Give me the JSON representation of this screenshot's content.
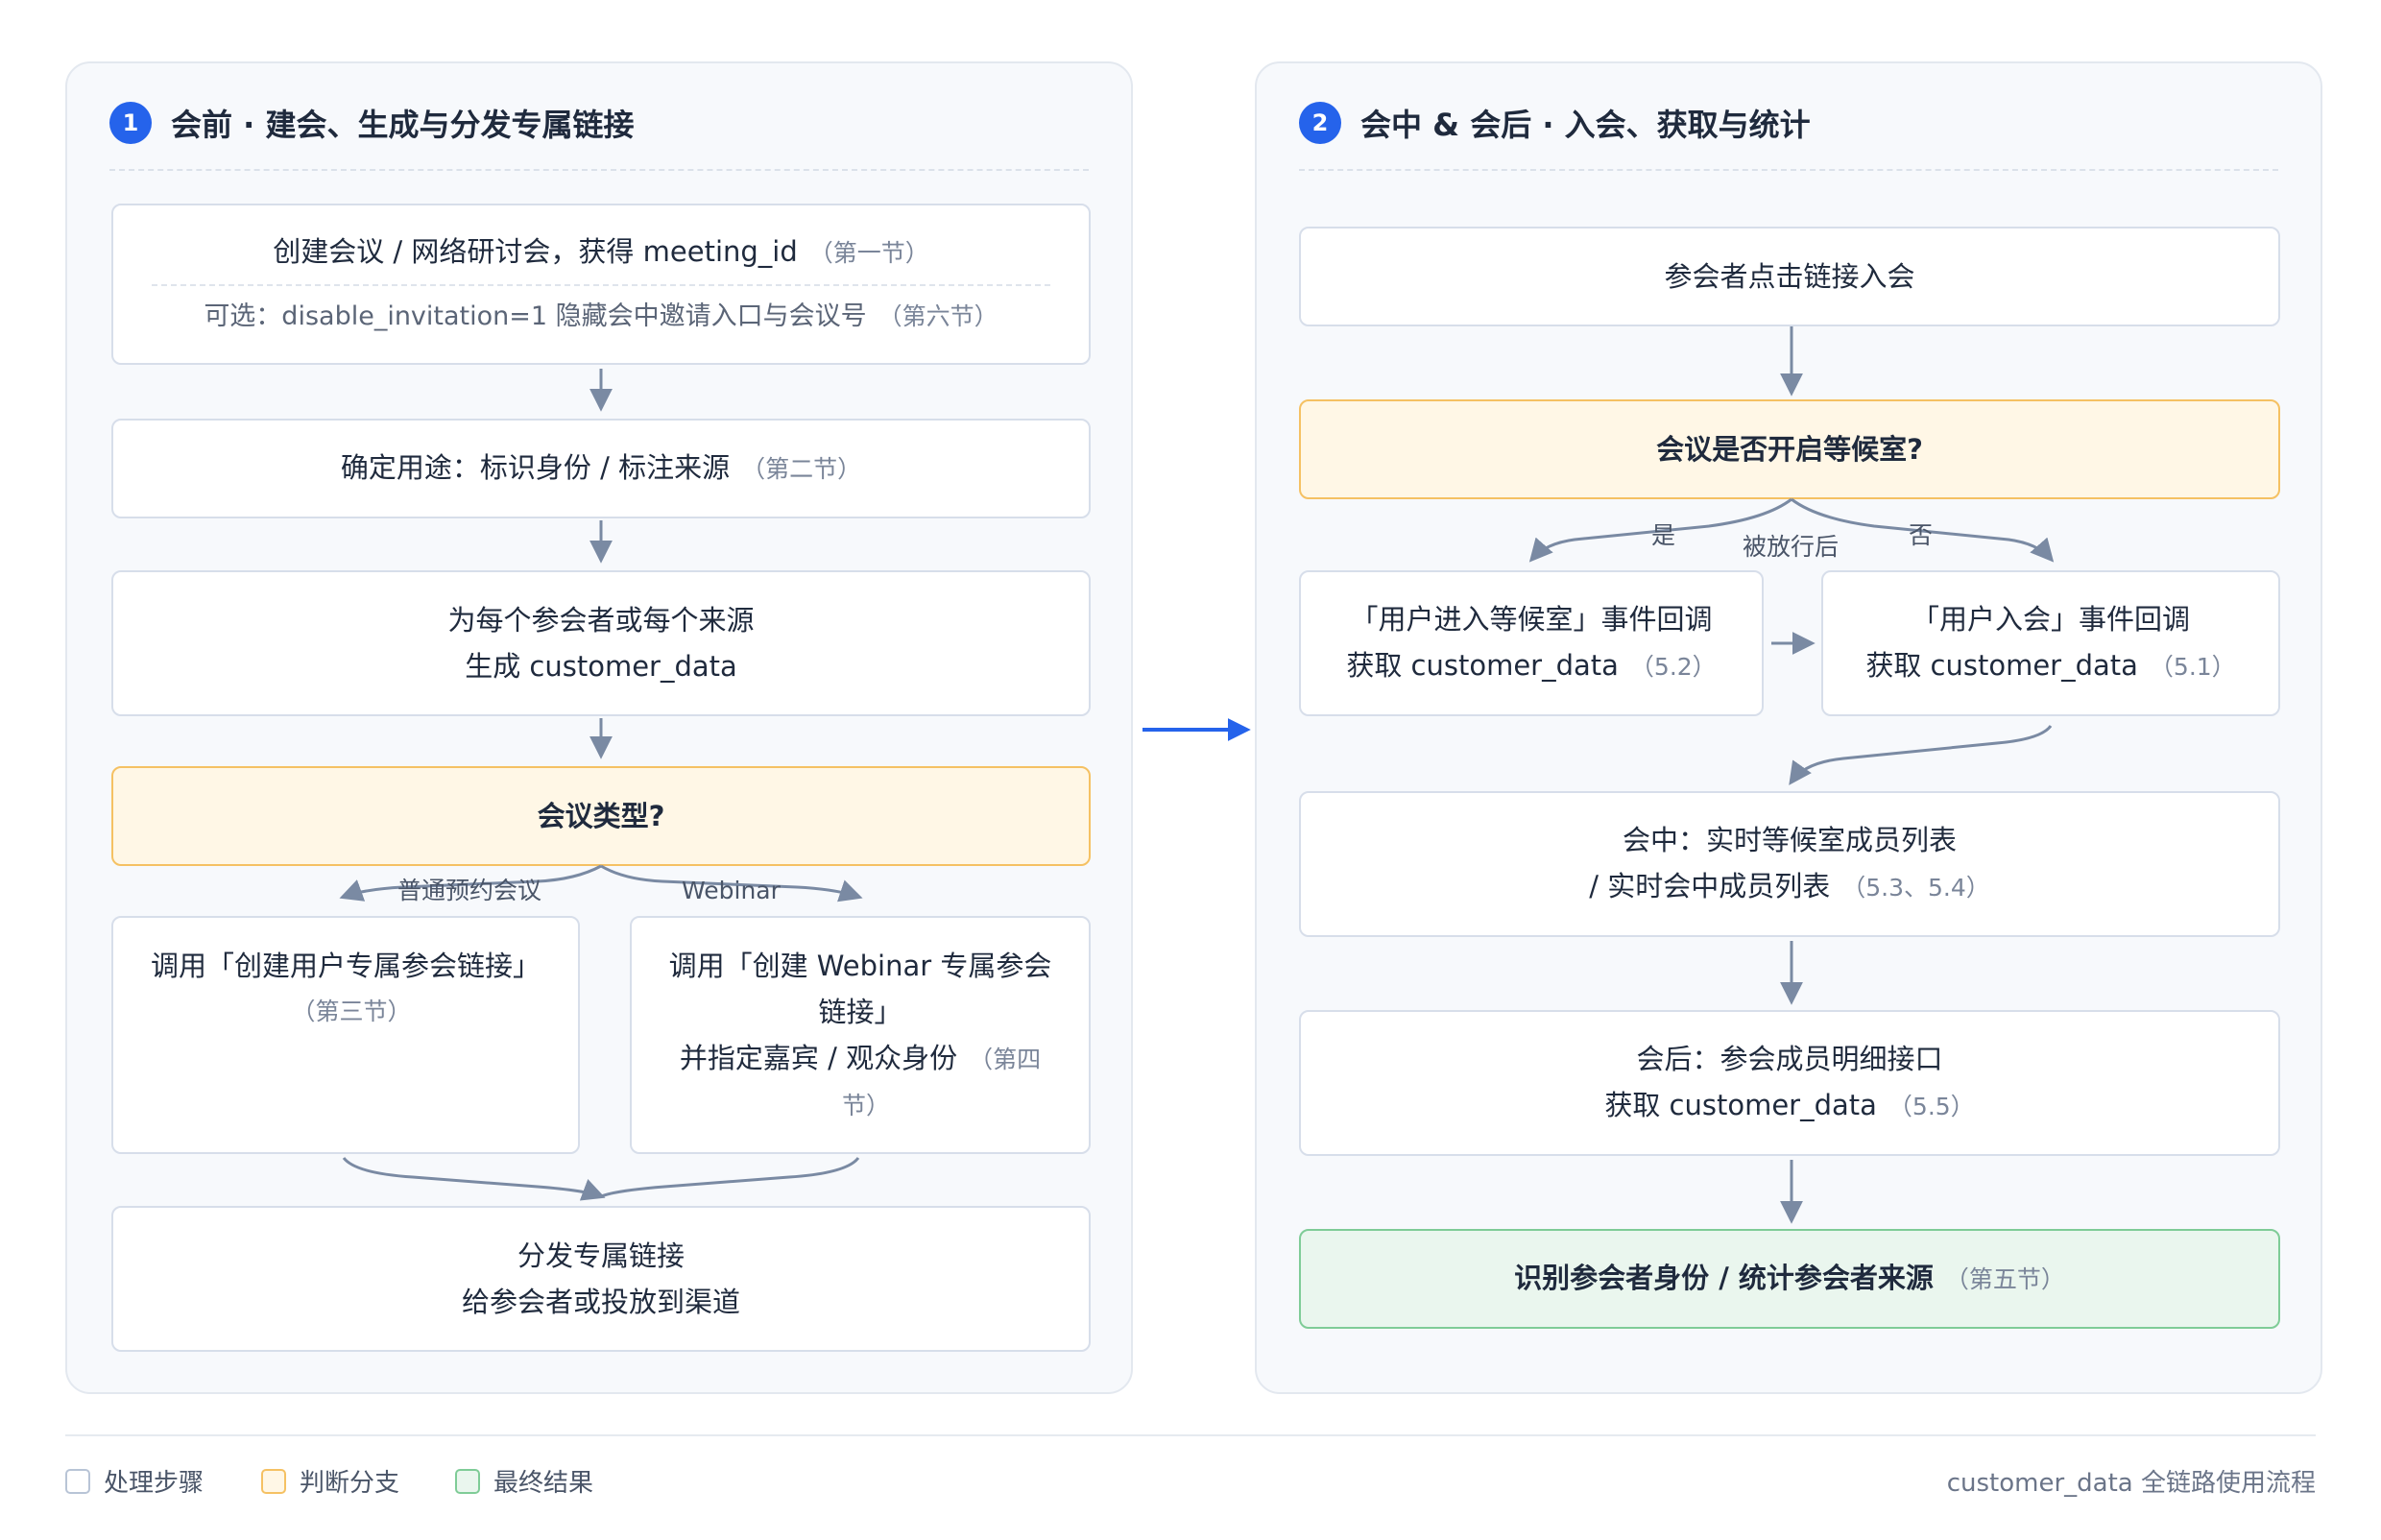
{
  "panel1": {
    "number": "1",
    "title": "会前 · 建会、生成与分发专属链接",
    "create_meeting": {
      "text": "创建会议 / 网络研讨会，获得 meeting_id",
      "ref": "（第一节）",
      "optional": "可选：disable_invitation=1 隐藏会中邀请入口与会议号",
      "optional_ref": "（第六节）"
    },
    "purpose": {
      "text": "确定用途：标识身份 / 标注来源",
      "ref": "（第二节）"
    },
    "generate": {
      "line1": "为每个参会者或每个来源",
      "line2": "生成 customer_data"
    },
    "meeting_type": {
      "text": "会议类型?"
    },
    "branch_regular": "普通预约会议",
    "branch_webinar": "Webinar",
    "user_link": {
      "text": "调用「创建用户专属参会链接」",
      "ref": "（第三节）"
    },
    "webinar_link": {
      "line1": "调用「创建 Webinar 专属参会",
      "line2": "链接」",
      "line3": "并指定嘉宾 / 观众身份",
      "ref": "（第四",
      "ref2": "节）"
    },
    "distribute": {
      "line1": "分发专属链接",
      "line2": "给参会者或投放到渠道"
    }
  },
  "panel2": {
    "number": "2",
    "title": "会中 & 会后 · 入会、获取与统计",
    "click": {
      "text": "参会者点击链接入会"
    },
    "waiting_room": {
      "text": "会议是否开启等候室?"
    },
    "branch_yes": "是",
    "branch_no": "否",
    "branch_admitted": "被放行后",
    "enter_waiting": {
      "line1": "「用户进入等候室」事件回调",
      "line2": "获取 customer_data",
      "ref": "（5.2）"
    },
    "join": {
      "line1": "「用户入会」事件回调",
      "line2": "获取 customer_data",
      "ref": "（5.1）"
    },
    "in_meeting": {
      "line1": "会中：实时等候室成员列表",
      "line2": "/ 实时会中成员列表",
      "ref": "（5.3、5.4）"
    },
    "after_meeting": {
      "line1": "会后：参会成员明细接口",
      "line2": "获取 customer_data",
      "ref": "（5.5）"
    },
    "result": {
      "text": "识别参会者身份 / 统计参会者来源",
      "ref": "（第五节）"
    }
  },
  "legend": {
    "step": "处理步骤",
    "decision": "判断分支",
    "result": "最终结果"
  },
  "footer": "customer_data 全链路使用流程",
  "colors": {
    "accent": "#2563eb",
    "decision_fill": "#fff7e6",
    "decision_border": "#f5c163",
    "result_fill": "#eaf6ee",
    "result_border": "#7fcc97",
    "connector": "#7a8aa3"
  }
}
